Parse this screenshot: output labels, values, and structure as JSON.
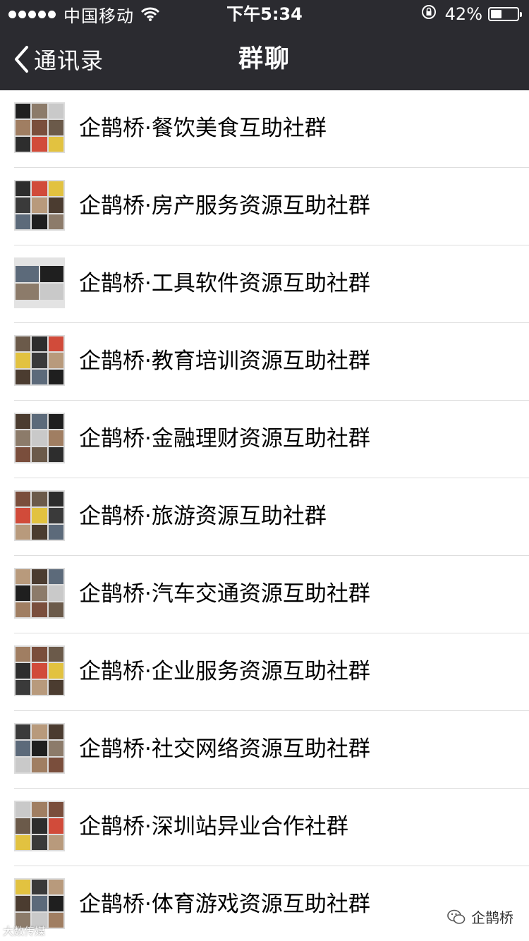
{
  "status_bar": {
    "carrier": "中国移动",
    "time": "下午5:34",
    "battery": "42%",
    "battery_level": 0.42
  },
  "nav": {
    "back_label": "通讯录",
    "title": "群聊"
  },
  "groups": [
    {
      "name": "企鹊桥·餐饮美食互助社群"
    },
    {
      "name": "企鹊桥·房产服务资源互助社群"
    },
    {
      "name": "企鹊桥·工具软件资源互助社群"
    },
    {
      "name": "企鹊桥·教育培训资源互助社群"
    },
    {
      "name": "企鹊桥·金融理财资源互助社群"
    },
    {
      "name": "企鹊桥·旅游资源互助社群"
    },
    {
      "name": "企鹊桥·汽车交通资源互助社群"
    },
    {
      "name": "企鹊桥·企业服务资源互助社群"
    },
    {
      "name": "企鹊桥·社交网络资源互助社群"
    },
    {
      "name": "企鹊桥·深圳站异业合作社群"
    },
    {
      "name": "企鹊桥·体育游戏资源互助社群"
    }
  ],
  "watermarks": {
    "left": "大数传媒",
    "right": "企鹊桥"
  },
  "colors": {
    "nav_bg": "#2b2b30",
    "separator": "#dedede",
    "text": "#000000"
  }
}
